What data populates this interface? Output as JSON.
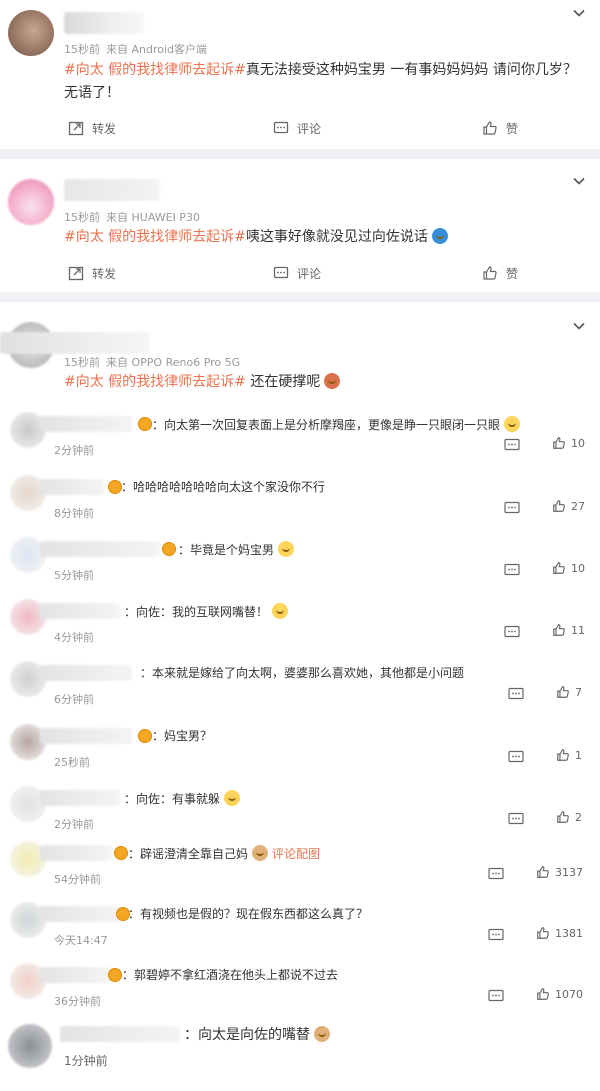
{
  "posts": [
    {
      "time": "15秒前",
      "source": "来自 Android客户端",
      "topic": "#向太 假的我找律师去起诉#",
      "text": "真无法接受这种妈宝男 一有事妈妈妈妈 请问你几岁？无语了！",
      "actions": {
        "repost": "转发",
        "comment": "评论",
        "like": "赞"
      }
    },
    {
      "time": "15秒前",
      "source": "来自 HUAWEI P30",
      "topic": "#向太 假的我找律师去起诉#",
      "text": "咦这事好像就没见过向佐说话",
      "actions": {
        "repost": "转发",
        "comment": "评论",
        "like": "赞"
      }
    },
    {
      "time": "15秒前",
      "source": "来自 OPPO Reno6 Pro 5G",
      "topic": "#向太 假的我找律师去起诉#",
      "text": " 还在硬撑呢"
    }
  ],
  "comments": [
    {
      "text": "：向太第一次回复表面上是分析摩羯座，更像是睁一只眼闭一只眼",
      "time": "2分钟前",
      "likes": "10"
    },
    {
      "text": "：哈哈哈哈哈哈哈向太这个家没你不行",
      "time": "8分钟前",
      "likes": "27"
    },
    {
      "text": "：毕竟是个妈宝男",
      "time": "5分钟前",
      "likes": "10"
    },
    {
      "text": "：向佐：我的互联网嘴替！",
      "time": "4分钟前",
      "likes": "11"
    },
    {
      "text": "：本来就是嫁给了向太啊，婆婆那么喜欢她，其他都是小问题",
      "time": "6分钟前",
      "likes": "7"
    },
    {
      "text": "：妈宝男？",
      "time": "25秒前",
      "likes": "1"
    },
    {
      "text": "：向佐：有事就躲",
      "time": "2分钟前",
      "likes": "2"
    },
    {
      "text": "：辟谣澄清全靠自己妈",
      "link": "评论配图",
      "time": "54分钟前",
      "likes": "3137"
    },
    {
      "text": "：有视频也是假的？现在假东西都这么真了？",
      "time": "今天14:47",
      "likes": "1381"
    },
    {
      "text": "：郭碧婷不拿红酒浇在他头上都说不过去",
      "time": "36分钟前",
      "likes": "1070"
    },
    {
      "text": "：向太是向佐的嘴替",
      "time": "1分钟前",
      "likes": ""
    }
  ]
}
